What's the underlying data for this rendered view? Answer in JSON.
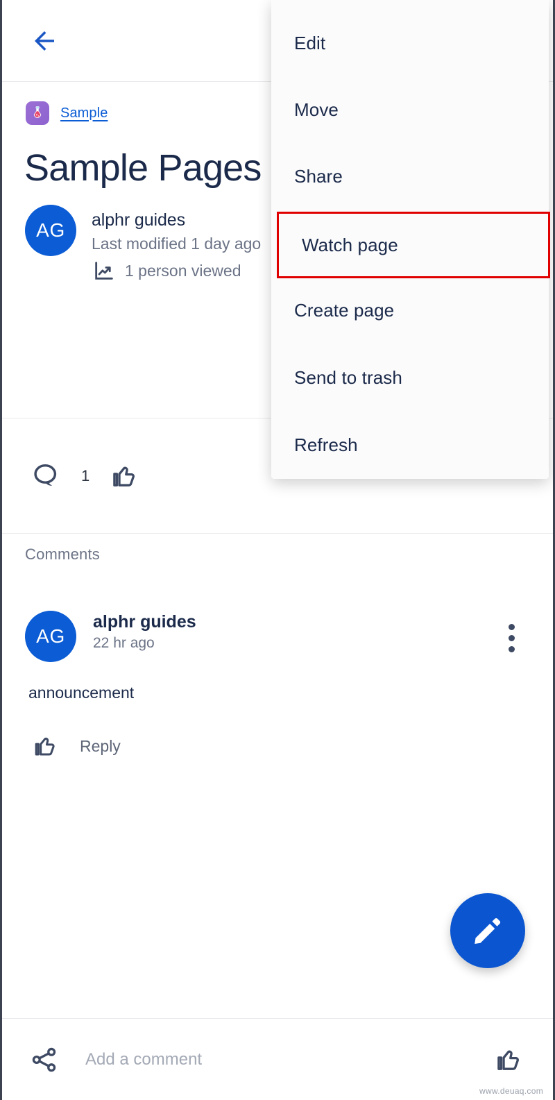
{
  "appbar": {
    "back_icon": "arrow-left-icon",
    "back_color": "#1a56c4"
  },
  "page": {
    "space_logo_icon": "flask-potion-icon",
    "space_name": "Sample",
    "title": "Sample Pages",
    "author_initials": "AG",
    "author_name": "alphr guides",
    "last_modified": "Last modified 1 day ago",
    "views_icon": "trending-up-icon",
    "views_text": "1 person viewed",
    "avatar_color": "#0b5cd5",
    "link_color": "#0b5cd5"
  },
  "reactions": {
    "comment_icon": "speech-bubble-icon",
    "comment_count": "1",
    "like_icon": "thumbs-up-icon"
  },
  "comments": {
    "section_label": "Comments",
    "items": [
      {
        "initials": "AG",
        "author": "alphr guides",
        "time": "22 hr ago",
        "body": "announcement",
        "like_icon": "thumbs-up-icon",
        "reply_label": "Reply",
        "overflow_icon": "more-vertical-icon"
      }
    ]
  },
  "fab": {
    "icon": "pencil-edit-icon",
    "color": "#0b56d0"
  },
  "bottom_bar": {
    "share_icon": "share-icon",
    "comment_placeholder": "Add a comment",
    "comment_value": "",
    "like_icon": "thumbs-up-icon"
  },
  "menu": {
    "highlight_color": "#e00000",
    "items": [
      {
        "label": "Edit",
        "highlighted": false
      },
      {
        "label": "Move",
        "highlighted": false
      },
      {
        "label": "Share",
        "highlighted": false
      },
      {
        "label": "Watch page",
        "highlighted": true
      },
      {
        "label": "Create page",
        "highlighted": false
      },
      {
        "label": "Send to trash",
        "highlighted": false
      },
      {
        "label": "Refresh",
        "highlighted": false
      }
    ]
  },
  "watermark": "www.deuaq.com"
}
